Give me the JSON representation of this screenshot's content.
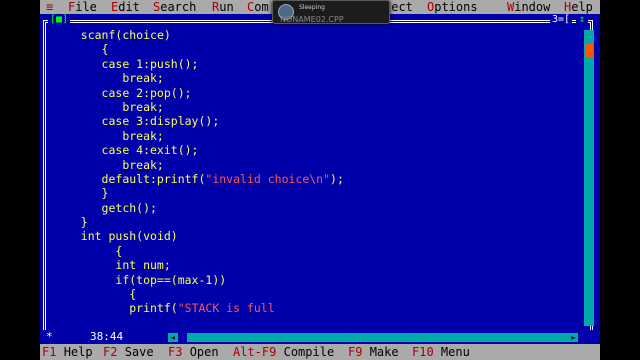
{
  "menu": {
    "system_icon": "≡",
    "items": [
      {
        "hot": "F",
        "rest": "ile"
      },
      {
        "hot": "E",
        "rest": "dit"
      },
      {
        "hot": "S",
        "rest": "earch"
      },
      {
        "hot": "R",
        "rest": "un"
      },
      {
        "hot": "C",
        "rest": "om"
      },
      {
        "hot": "",
        "rest": "ject"
      },
      {
        "hot": "O",
        "rest": "ptions"
      },
      {
        "hot": "W",
        "rest": "indow"
      },
      {
        "hot": "H",
        "rest": "elp"
      }
    ]
  },
  "tooltip": {
    "text": "Sleeping",
    "title": "NONAME02.CPP"
  },
  "window": {
    "close_label": "[■]",
    "number_label": "3=[",
    "zoom_icon": "↕"
  },
  "code_lines": [
    {
      "indent": "   ",
      "a": "scanf(choice)",
      "str": "",
      "b": ""
    },
    {
      "indent": "      ",
      "a": "{",
      "str": "",
      "b": ""
    },
    {
      "indent": "      ",
      "a": "case 1:push();",
      "str": "",
      "b": ""
    },
    {
      "indent": "         ",
      "a": "break;",
      "str": "",
      "b": ""
    },
    {
      "indent": "      ",
      "a": "case 2:pop();",
      "str": "",
      "b": ""
    },
    {
      "indent": "         ",
      "a": "break;",
      "str": "",
      "b": ""
    },
    {
      "indent": "      ",
      "a": "case 3:display();",
      "str": "",
      "b": ""
    },
    {
      "indent": "         ",
      "a": "break;",
      "str": "",
      "b": ""
    },
    {
      "indent": "      ",
      "a": "case 4:exit();",
      "str": "",
      "b": ""
    },
    {
      "indent": "         ",
      "a": "break;",
      "str": "",
      "b": ""
    },
    {
      "indent": "      ",
      "a": "default:printf(",
      "str": "\"invalid choice\\n\"",
      "b": ");"
    },
    {
      "indent": "      ",
      "a": "}",
      "str": "",
      "b": ""
    },
    {
      "indent": "      ",
      "a": "getch();",
      "str": "",
      "b": ""
    },
    {
      "indent": "   ",
      "a": "}",
      "str": "",
      "b": ""
    },
    {
      "indent": "   ",
      "a": "int push(void)",
      "str": "",
      "b": ""
    },
    {
      "indent": "        ",
      "a": "{",
      "str": "",
      "b": ""
    },
    {
      "indent": "        ",
      "a": "int num;",
      "str": "",
      "b": ""
    },
    {
      "indent": "        ",
      "a": "if(top==(max-1))",
      "str": "",
      "b": ""
    },
    {
      "indent": "          ",
      "a": "{",
      "str": "",
      "b": ""
    },
    {
      "indent": "          ",
      "a": "printf(",
      "str": "\"STACK is full",
      "b": ""
    }
  ],
  "status": {
    "modified_marker": "*",
    "cursor_position": "38:44"
  },
  "fkeys": [
    {
      "key": "F1",
      "label": "Help"
    },
    {
      "key": "F2",
      "label": "Save"
    },
    {
      "key": "F3",
      "label": "Open"
    },
    {
      "key": "Alt-F9",
      "label": "Compile"
    },
    {
      "key": "F9",
      "label": "Make"
    },
    {
      "key": "F10",
      "label": "Menu"
    }
  ],
  "colors": {
    "editor_bg": "#0000aa",
    "code_text": "#ffff55",
    "string_text": "#ff5555",
    "menu_bg": "#aaaaaa",
    "hotkey": "#aa0000",
    "scrollbar": "#00aaaa"
  }
}
